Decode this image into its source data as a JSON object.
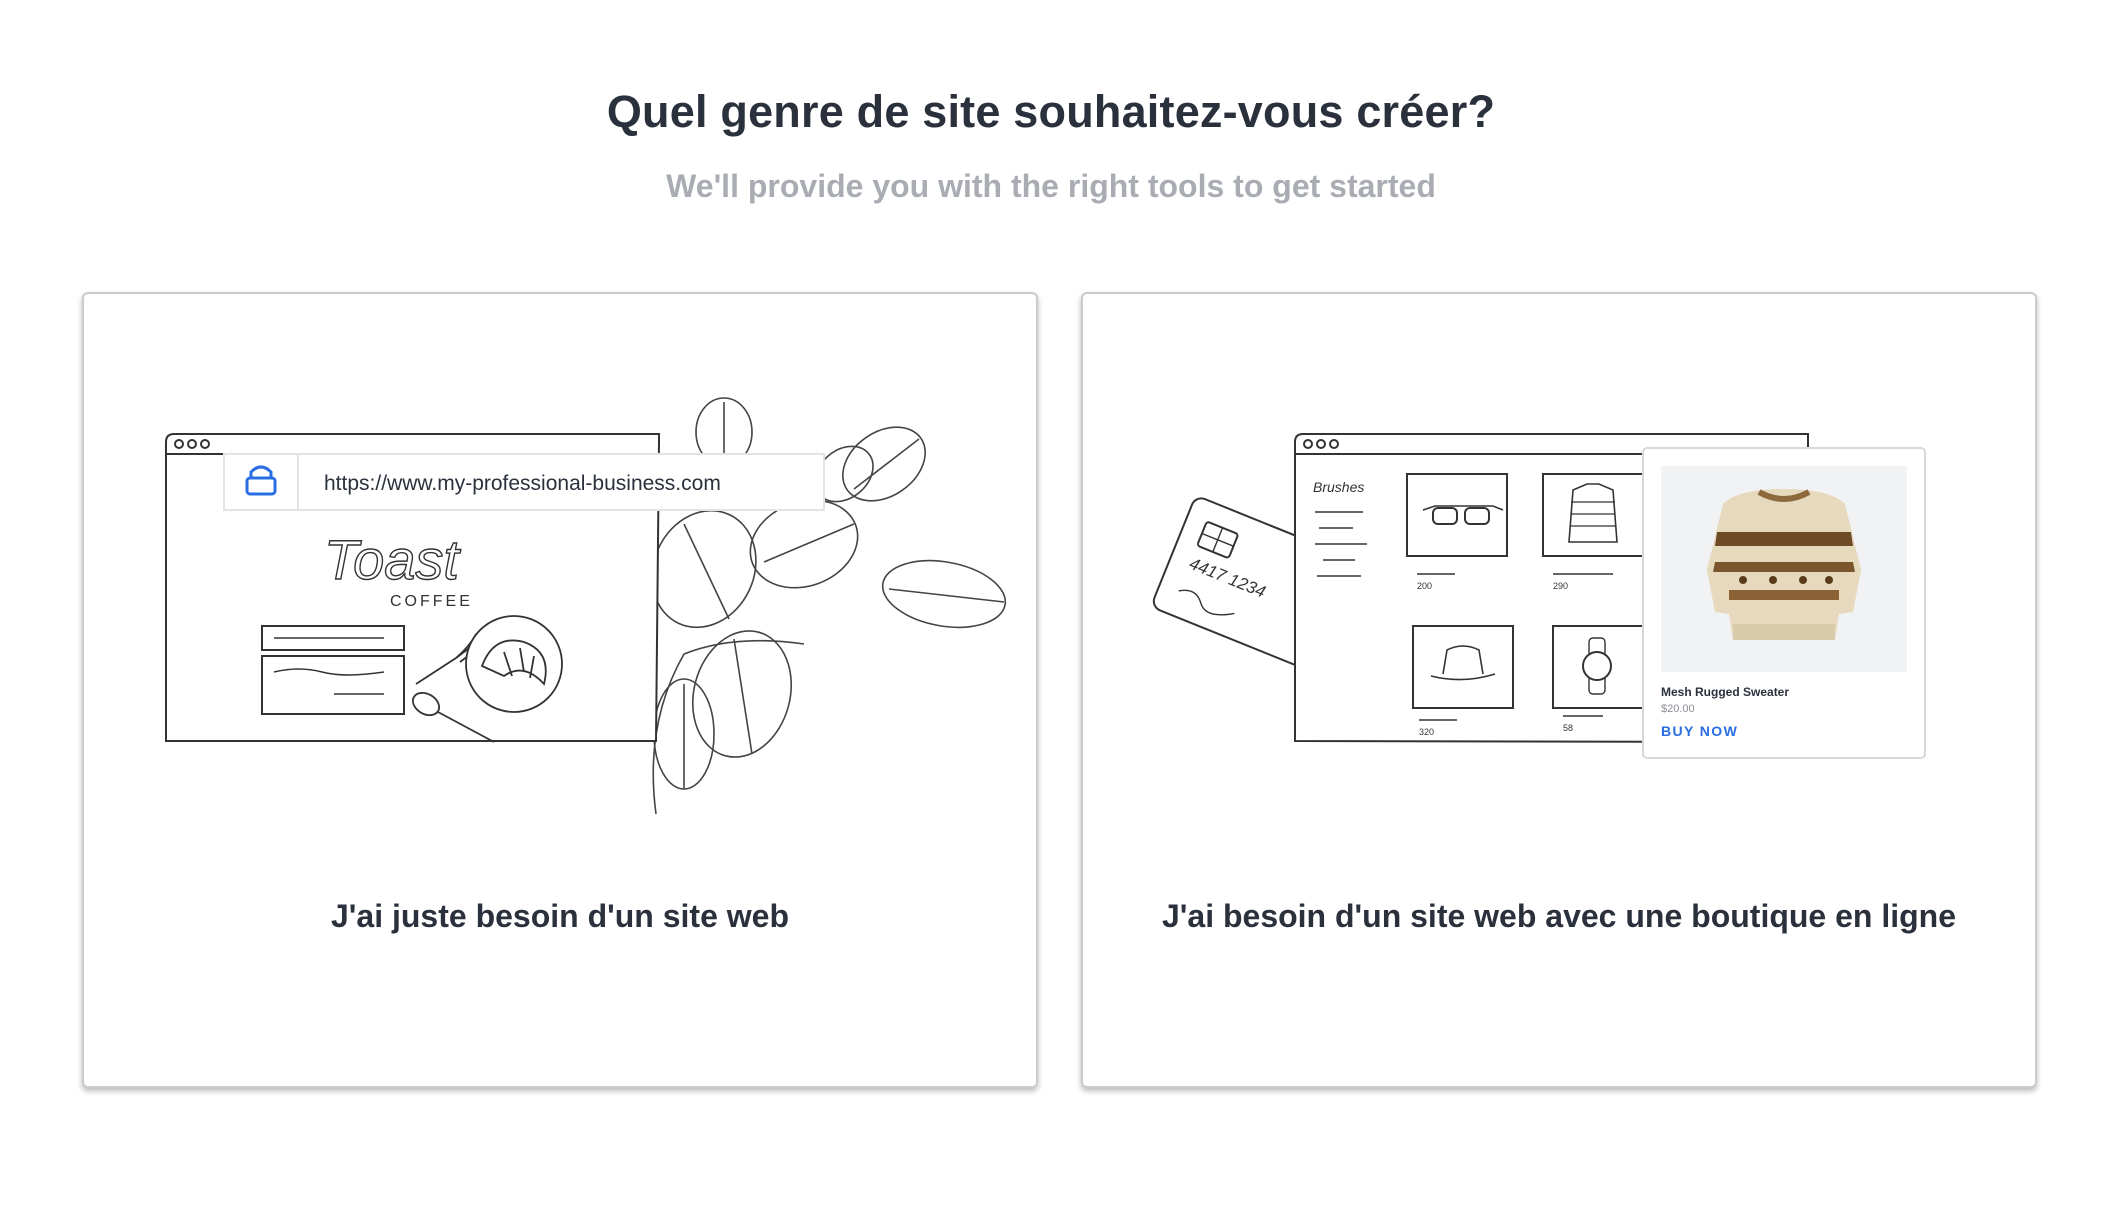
{
  "header": {
    "title": "Quel genre de site souhaitez-vous créer?",
    "subtitle": "We'll provide you with the right tools to get started"
  },
  "options": [
    {
      "label": "J'ai juste besoin d'un site web",
      "illustration": {
        "url": "https://www.my-professional-business.com",
        "brand_script": "Toast",
        "brand_word": "COFFEE",
        "icons": [
          "lock-icon",
          "plant-icon",
          "fork-icon",
          "spoon-icon",
          "croissant-icon"
        ]
      }
    },
    {
      "label": "J'ai besoin d'un site web avec une boutique en ligne",
      "illustration": {
        "store_name": "Brushes",
        "card_number": "4417 1234",
        "product_prices": [
          "200",
          "290",
          "320",
          "58"
        ],
        "product": {
          "name": "Mesh Rugged Sweater",
          "price": "$20.00",
          "cta": "BUY NOW"
        },
        "icons": [
          "credit-card-icon",
          "glasses-icon",
          "shirt-icon",
          "hat-icon",
          "watch-icon",
          "sweater-image"
        ]
      }
    }
  ],
  "colors": {
    "text_dark": "#2b313c",
    "text_muted": "#a9adb3",
    "accent_blue": "#2a6ce4",
    "card_border": "#c9cbcf"
  }
}
